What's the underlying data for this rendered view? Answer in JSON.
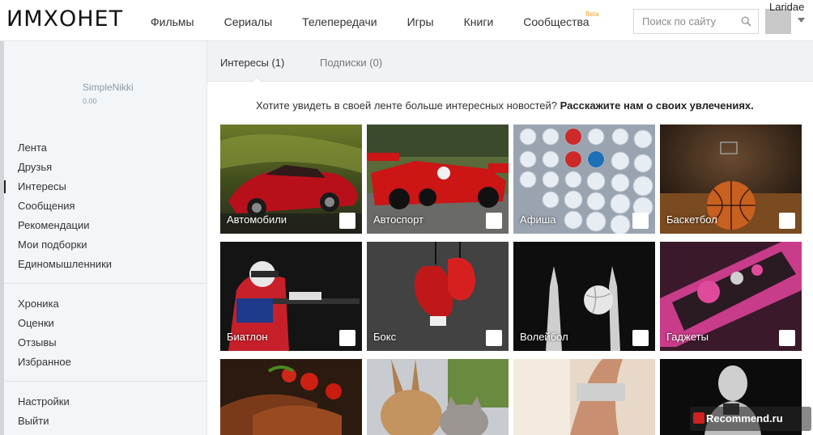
{
  "header": {
    "logo": "ИМХОНЕТ",
    "nav": [
      {
        "label": "Фильмы"
      },
      {
        "label": "Сериалы"
      },
      {
        "label": "Телепередачи"
      },
      {
        "label": "Игры"
      },
      {
        "label": "Книги"
      },
      {
        "label": "Сообщества",
        "badge": "Beta"
      }
    ],
    "search": {
      "placeholder": "Поиск по сайту",
      "value": ""
    },
    "user": {
      "name": "Laridae"
    }
  },
  "sidebar": {
    "profile": {
      "name": "SimpleNikki",
      "rating": "0.00"
    },
    "menu_main": [
      "Лента",
      "Друзья",
      "Интересы",
      "Сообщения",
      "Рекомендации",
      "Мои подборки",
      "Единомышленники"
    ],
    "active_item": "Интересы",
    "menu_history": [
      "Хроника",
      "Оценки",
      "Отзывы",
      "Избранное"
    ],
    "menu_account": [
      "Настройки",
      "Выйти"
    ]
  },
  "content": {
    "tabs": [
      {
        "label": "Интересы (1)",
        "active": true
      },
      {
        "label": "Подписки (0)",
        "active": false
      }
    ],
    "promo_text": "Хотите увидеть в своей ленте больше интересных новостей?",
    "promo_link": "Расскажите нам о своих увлечениях.",
    "interests": [
      {
        "label": "Автомобили",
        "icon": "car-photo"
      },
      {
        "label": "Автоспорт",
        "icon": "formula1-photo"
      },
      {
        "label": "Афиша",
        "icon": "calendar-buttons-photo"
      },
      {
        "label": "Баскетбол",
        "icon": "basketball-photo"
      },
      {
        "label": "Биатлон",
        "icon": "biathlon-photo"
      },
      {
        "label": "Бокс",
        "icon": "boxing-gloves-photo"
      },
      {
        "label": "Волейбол",
        "icon": "volleyball-photo"
      },
      {
        "label": "Гаджеты",
        "icon": "gadget-photo"
      },
      {
        "label": "",
        "icon": "food-photo"
      },
      {
        "label": "",
        "icon": "animals-photo"
      },
      {
        "label": "",
        "icon": "fitness-photo"
      },
      {
        "label": "",
        "icon": "portrait-photo"
      }
    ]
  },
  "watermark": {
    "text": "Recommend.ru"
  }
}
